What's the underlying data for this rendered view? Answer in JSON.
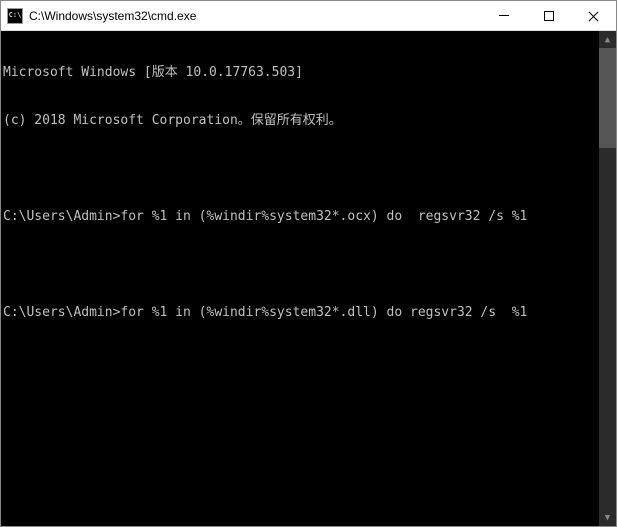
{
  "window": {
    "icon_label": "C:\\",
    "title": "C:\\Windows\\system32\\cmd.exe",
    "minimize": "minimize",
    "maximize": "maximize",
    "close": "close"
  },
  "terminal": {
    "lines": [
      "Microsoft Windows [版本 10.0.17763.503]",
      "(c) 2018 Microsoft Corporation。保留所有权利。",
      "",
      "C:\\Users\\Admin>for %1 in (%windir%system32*.ocx) do  regsvr32 /s %1",
      "",
      "C:\\Users\\Admin>for %1 in (%windir%system32*.dll) do regsvr32 /s  %1",
      ""
    ]
  }
}
